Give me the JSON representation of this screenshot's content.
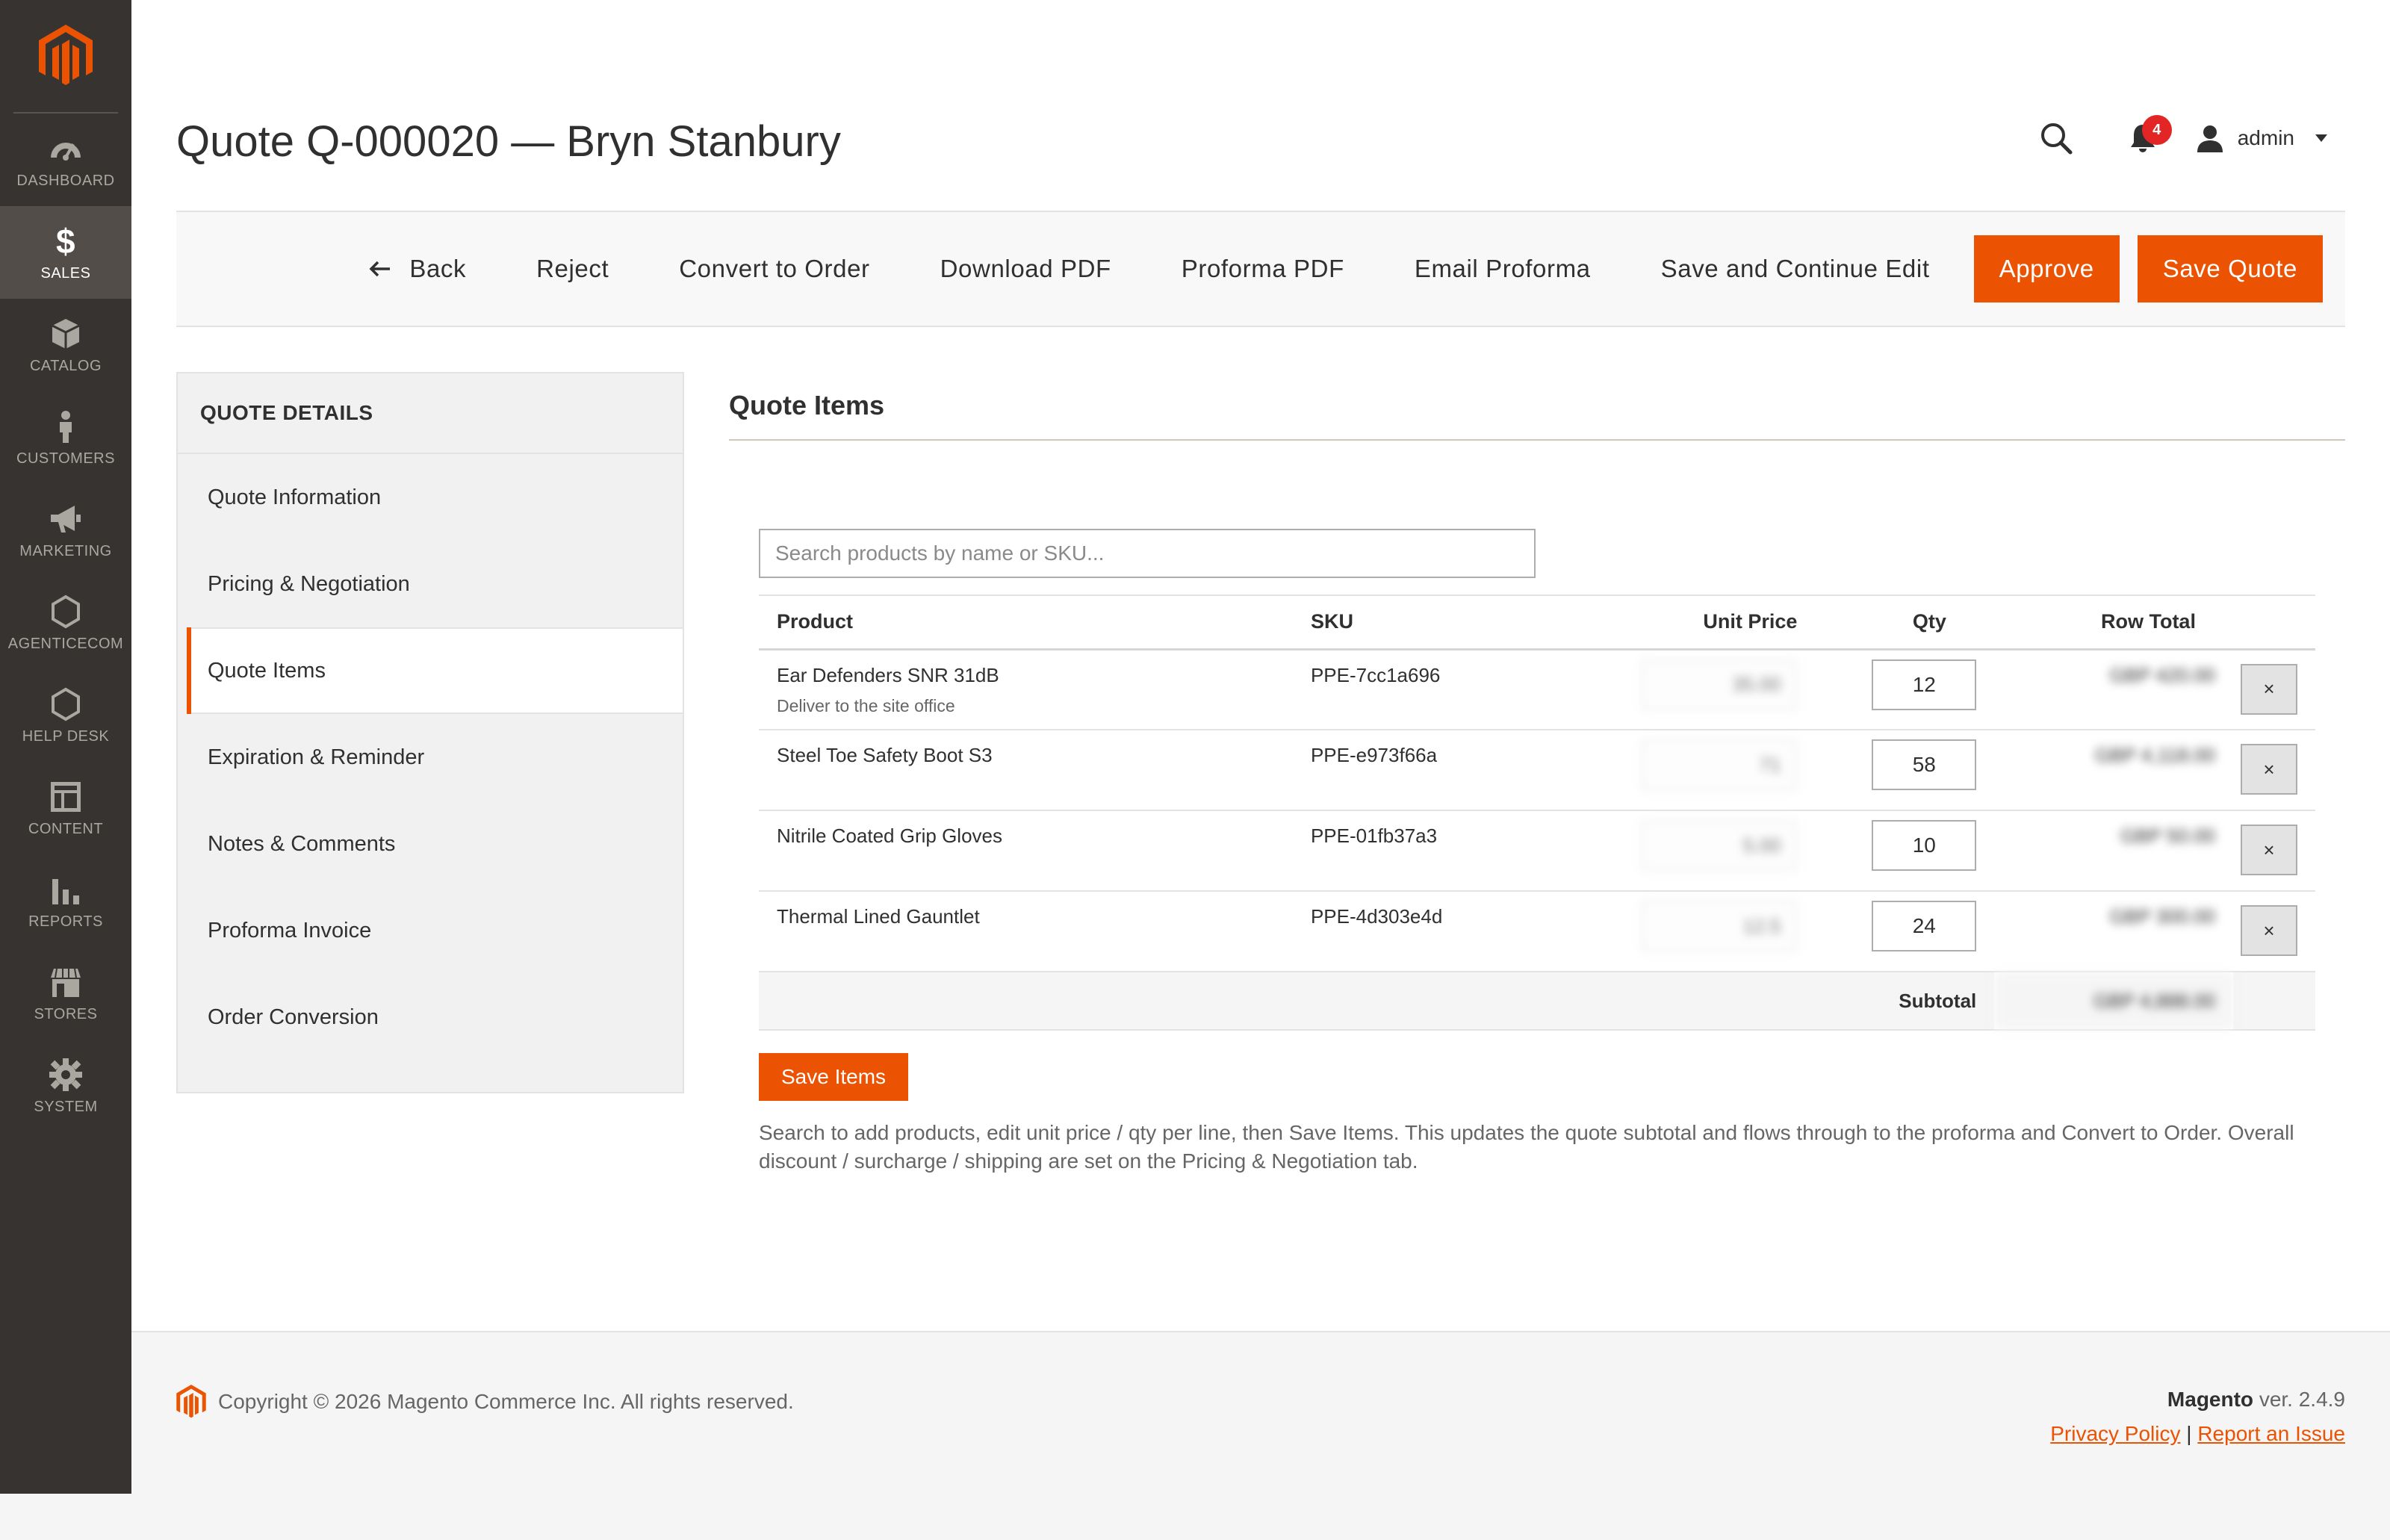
{
  "nav": {
    "items": [
      {
        "label": "DASHBOARD",
        "icon": "dashboard-icon"
      },
      {
        "label": "SALES",
        "icon": "dollar-icon",
        "glyph": "$"
      },
      {
        "label": "CATALOG",
        "icon": "catalog-icon"
      },
      {
        "label": "CUSTOMERS",
        "icon": "customers-icon"
      },
      {
        "label": "MARKETING",
        "icon": "megaphone-icon"
      },
      {
        "label": "AGENTICECOM",
        "icon": "hexagon-icon"
      },
      {
        "label": "HELP DESK",
        "icon": "hexagon-icon"
      },
      {
        "label": "CONTENT",
        "icon": "content-icon"
      },
      {
        "label": "REPORTS",
        "icon": "bar-chart-icon"
      },
      {
        "label": "STORES",
        "icon": "store-icon"
      },
      {
        "label": "SYSTEM",
        "icon": "gear-icon"
      }
    ]
  },
  "header": {
    "title": "Quote Q-000020 — Bryn Stanbury",
    "notification_count": "4",
    "user": "admin"
  },
  "actions": {
    "back": "Back",
    "reject": "Reject",
    "convert": "Convert to Order",
    "download_pdf": "Download PDF",
    "proforma_pdf": "Proforma PDF",
    "email_proforma": "Email Proforma",
    "save_continue": "Save and Continue Edit",
    "approve": "Approve",
    "save_quote": "Save Quote"
  },
  "tabs": {
    "title": "QUOTE DETAILS",
    "items": [
      "Quote Information",
      "Pricing & Negotiation",
      "Quote Items",
      "Expiration & Reminder",
      "Notes & Comments",
      "Proforma Invoice",
      "Order Conversion"
    ]
  },
  "section": {
    "title": "Quote Items",
    "search_placeholder": "Search products by name or SKU..."
  },
  "table": {
    "headers": {
      "product": "Product",
      "sku": "SKU",
      "unit_price": "Unit Price",
      "qty": "Qty",
      "row_total": "Row Total"
    },
    "rows": [
      {
        "product": "Ear Defenders SNR 31dB",
        "note": "Deliver to the site office",
        "sku": "PPE-7cc1a696",
        "unit_price": "35.00",
        "qty": "12",
        "row_total": "GBP 420.00"
      },
      {
        "product": "Steel Toe Safety Boot S3",
        "note": "",
        "sku": "PPE-e973f66a",
        "unit_price": "71",
        "qty": "58",
        "row_total": "GBP 4,118.00"
      },
      {
        "product": "Nitrile Coated Grip Gloves",
        "note": "",
        "sku": "PPE-01fb37a3",
        "unit_price": "5.00",
        "qty": "10",
        "row_total": "GBP 50.00"
      },
      {
        "product": "Thermal Lined Gauntlet",
        "note": "",
        "sku": "PPE-4d303e4d",
        "unit_price": "12.5",
        "qty": "24",
        "row_total": "GBP 300.00"
      }
    ],
    "delete_label": "×",
    "subtotal_label": "Subtotal",
    "subtotal_value": "GBP 4,888.00"
  },
  "save_items_label": "Save Items",
  "help_text": "Search to add products, edit unit price / qty per line, then Save Items. This updates the quote subtotal and flows through to the proforma and Convert to Order. Overall discount / surcharge / shipping are set on the Pricing & Negotiation tab.",
  "footer": {
    "copyright": "Copyright © 2026 Magento Commerce Inc. All rights reserved.",
    "brand": "Magento",
    "version": "ver. 2.4.9",
    "privacy": "Privacy Policy",
    "separator": "|",
    "report": "Report an Issue"
  },
  "colors": {
    "accent": "#eb5202",
    "nav_bg": "#373330",
    "badge": "#e22626"
  }
}
